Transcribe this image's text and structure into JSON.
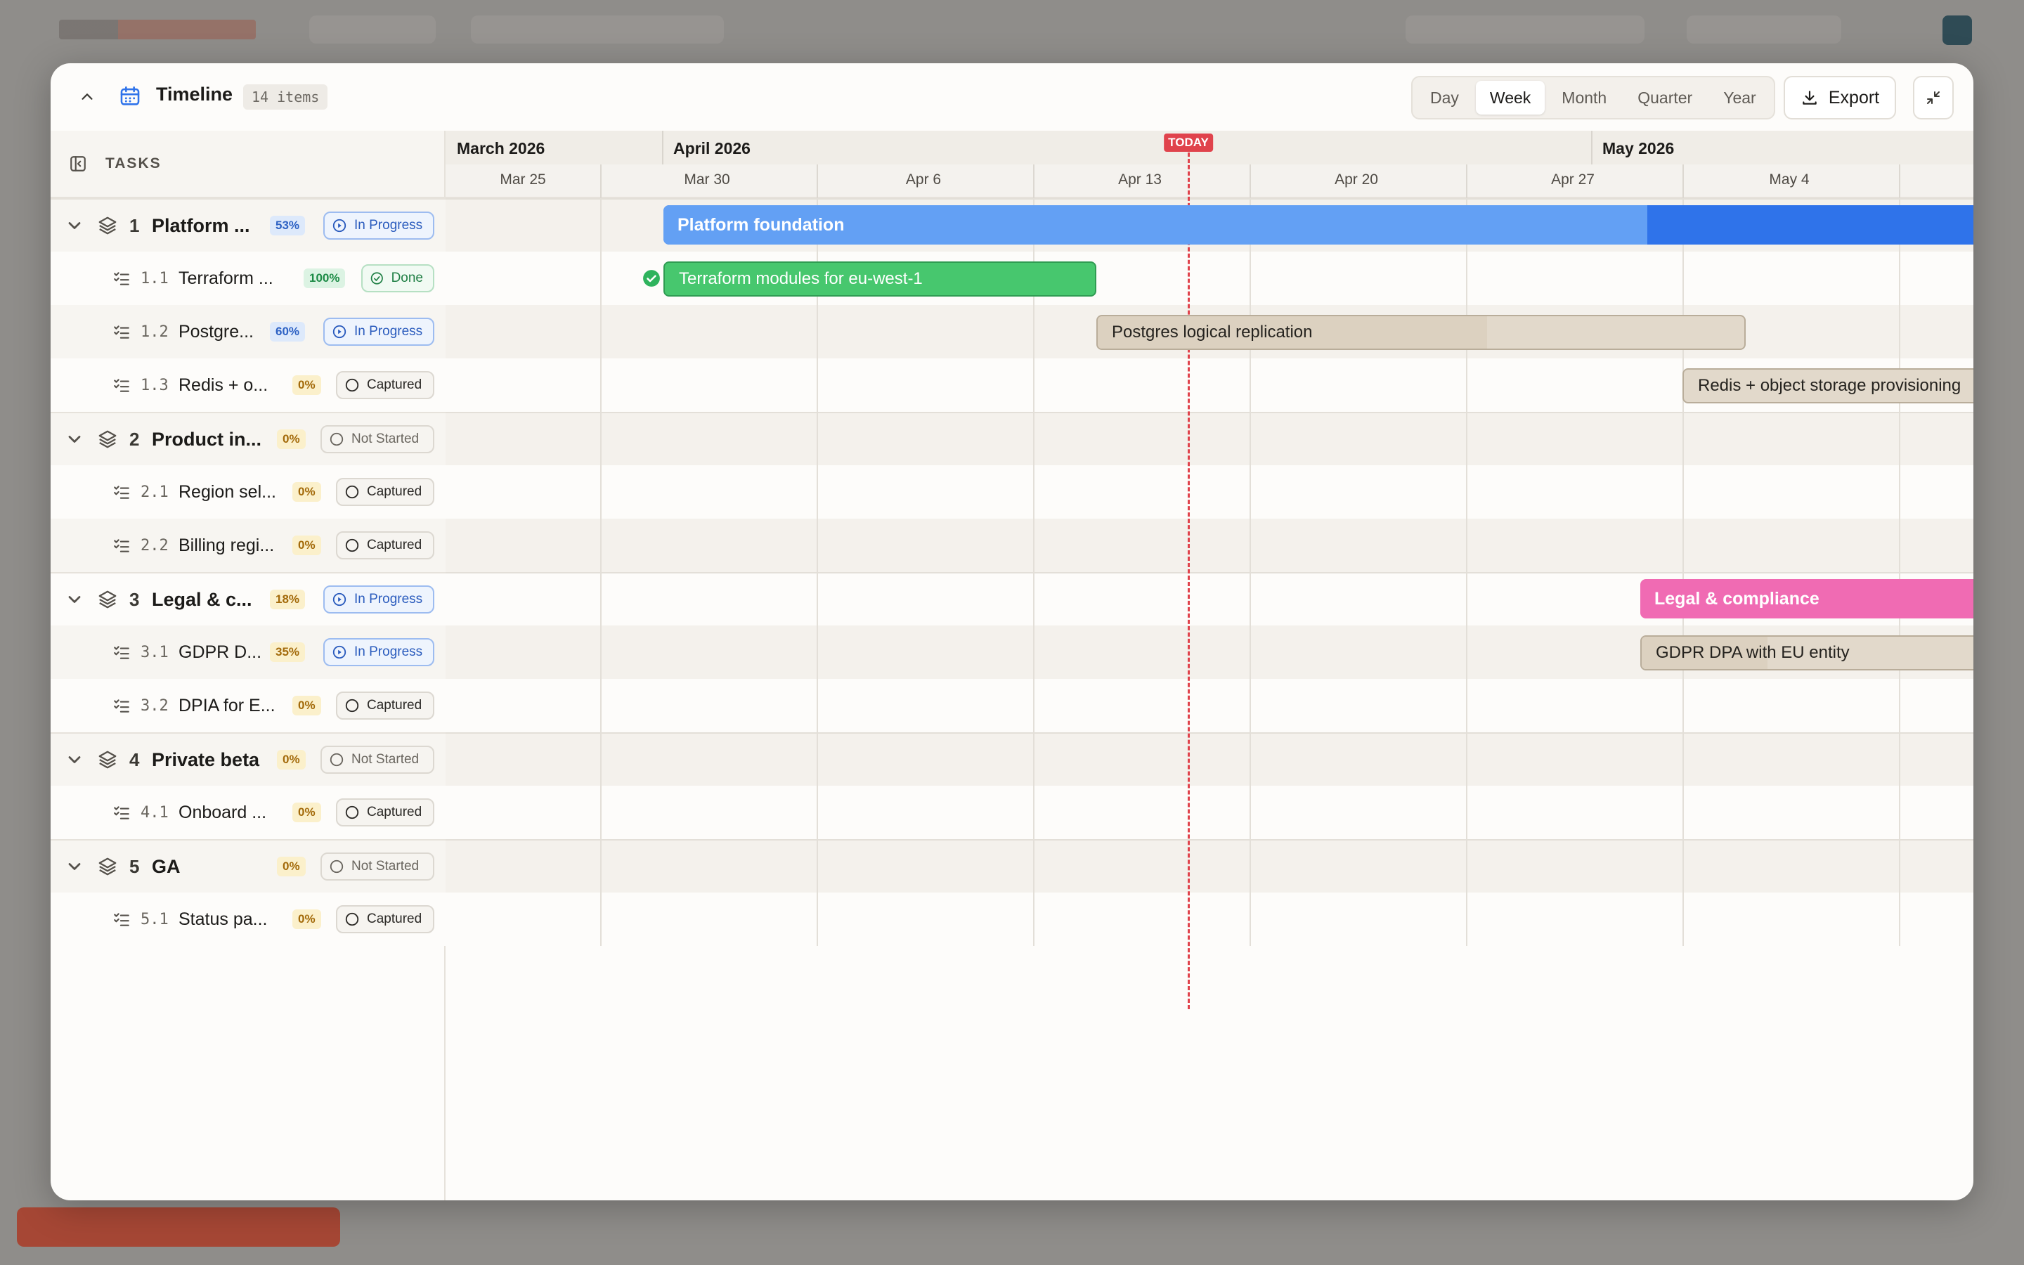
{
  "modal": {
    "title": "Timeline",
    "item_count": "14 items",
    "views": [
      "Day",
      "Week",
      "Month",
      "Quarter",
      "Year"
    ],
    "active_view": "Week",
    "export_label": "Export"
  },
  "tasks_header": "TASKS",
  "timeline": {
    "months": [
      "March 2026",
      "April 2026",
      "May 2026"
    ],
    "weeks": [
      "Mar 25",
      "Mar 30",
      "Apr 6",
      "Apr 13",
      "Apr 20",
      "Apr 27",
      "May 4"
    ],
    "today_label": "TODAY"
  },
  "rows": [
    {
      "type": "group",
      "num": "1",
      "name": "Platform ...",
      "pct": "53%",
      "status": "In Progress",
      "bar_label": "Platform foundation",
      "progress": 0.53
    },
    {
      "type": "task",
      "num": "1.1",
      "name": "Terraform ...",
      "pct": "100%",
      "status": "Done",
      "bar_label": "Terraform modules for eu-west-1",
      "progress": 1.0
    },
    {
      "type": "task",
      "num": "1.2",
      "name": "Postgre...",
      "pct": "60%",
      "status": "In Progress",
      "bar_label": "Postgres logical replication",
      "progress": 0.6
    },
    {
      "type": "task",
      "num": "1.3",
      "name": "Redis + o...",
      "pct": "0%",
      "status": "Captured",
      "bar_label": "Redis + object storage provisioning",
      "progress": 0
    },
    {
      "type": "group",
      "num": "2",
      "name": "Product in...",
      "pct": "0%",
      "status": "Not Started"
    },
    {
      "type": "task",
      "num": "2.1",
      "name": "Region sel...",
      "pct": "0%",
      "status": "Captured"
    },
    {
      "type": "task",
      "num": "2.2",
      "name": "Billing regi...",
      "pct": "0%",
      "status": "Captured"
    },
    {
      "type": "group",
      "num": "3",
      "name": "Legal & c...",
      "pct": "18%",
      "status": "In Progress",
      "bar_label": "Legal & compliance",
      "progress": 0.18
    },
    {
      "type": "task",
      "num": "3.1",
      "name": "GDPR D...",
      "pct": "35%",
      "status": "In Progress",
      "bar_label": "GDPR DPA with EU entity",
      "progress": 0.35
    },
    {
      "type": "task",
      "num": "3.2",
      "name": "DPIA for E...",
      "pct": "0%",
      "status": "Captured"
    },
    {
      "type": "group",
      "num": "4",
      "name": "Private beta",
      "pct": "0%",
      "status": "Not Started"
    },
    {
      "type": "task",
      "num": "4.1",
      "name": "Onboard ...",
      "pct": "0%",
      "status": "Captured"
    },
    {
      "type": "group",
      "num": "5",
      "name": "GA",
      "pct": "0%",
      "status": "Not Started"
    },
    {
      "type": "task",
      "num": "5.1",
      "name": "Status pa...",
      "pct": "0%",
      "status": "Captured"
    }
  ],
  "colors": {
    "accent_blue": "#2f73ea",
    "done_green": "#47c76e",
    "legal_pink": "#f06bb3",
    "today_red": "#e0434c"
  }
}
